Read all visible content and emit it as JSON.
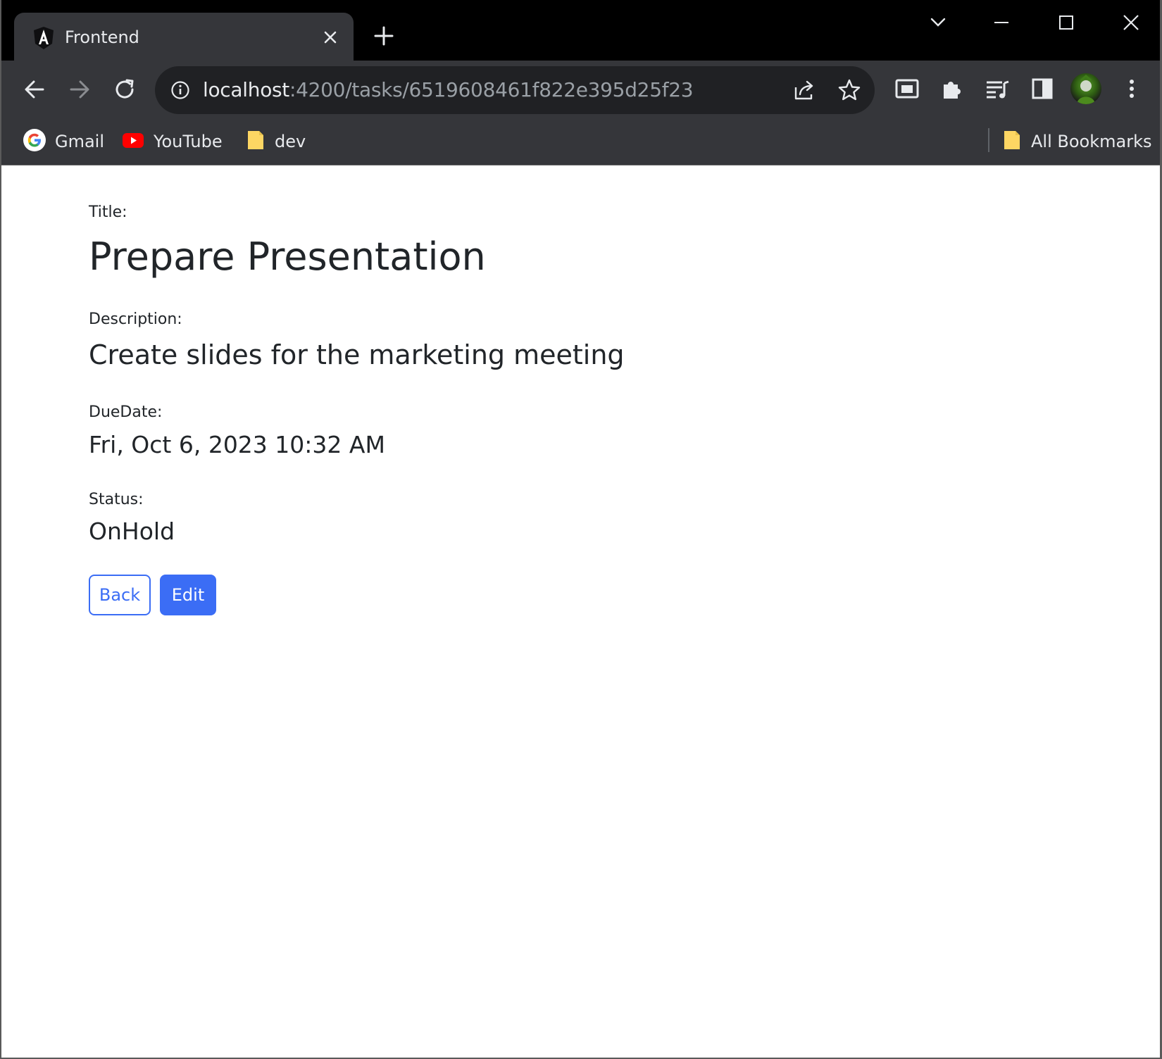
{
  "browser": {
    "tab": {
      "title": "Frontend",
      "favicon": "angular-logo-icon"
    },
    "address": {
      "host": "localhost",
      "path": ":4200/tasks/6519608461f822e395d25f23"
    },
    "bookmarks": [
      {
        "label": "Gmail",
        "icon": "google-icon"
      },
      {
        "label": "YouTube",
        "icon": "youtube-icon"
      },
      {
        "label": "dev",
        "icon": "folder-icon"
      }
    ],
    "all_bookmarks": "All Bookmarks"
  },
  "task": {
    "title_label": "Title:",
    "title": "Prepare Presentation",
    "description_label": "Description:",
    "description": "Create slides for the marketing meeting",
    "duedate_label": "DueDate:",
    "duedate": "Fri, Oct 6, 2023 10:32 AM",
    "status_label": "Status:",
    "status": "OnHold"
  },
  "actions": {
    "back": "Back",
    "edit": "Edit"
  },
  "colors": {
    "primary": "#3b6df5",
    "text": "#212529",
    "chrome_dark": "#35363a"
  }
}
